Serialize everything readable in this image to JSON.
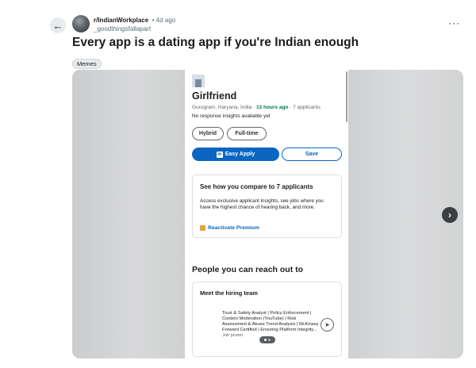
{
  "post": {
    "subreddit": "r/IndianWorkplace",
    "time": "• 4d ago",
    "username": "_goodthingsfallapart",
    "title": "Every app is a dating app if you're Indian enough",
    "flair": "Memes",
    "more_label": "···",
    "back_label": "←"
  },
  "screenshot": {
    "job_title": "Girlfriend",
    "location": "Gurugram, Haryana, India · ",
    "posted_highlight": "13 hours ago",
    "applicants": " · 7 applicants",
    "insight_note": "No response insights available yet",
    "pills": [
      "Hybrid",
      "Full-time"
    ],
    "apply_label": "Easy Apply",
    "save_label": "Save",
    "compare_heading": "See how you compare to 7 applicants",
    "compare_body": "Access exclusive applicant insights, see jobs where you have the highest chance of hearing back, and more.",
    "premium_label": "Reactivate Premium",
    "reach_title": "People you can reach out to",
    "team_heading": "Meet the hiring team",
    "poster_headline": "Trust & Safety Analyst | Policy Enforcement | Content Moderation (YouTube) | Risk Assessment & Abuse Trend Analysis | McKinsey Forward Certified | Ensuring Platform Integrity...",
    "poster_role": "Job poster"
  },
  "carousel": {
    "next_label": "›",
    "pages": 2,
    "current_page": 1
  },
  "colors": {
    "linkedin_blue": "#0a66c2",
    "highlight_green": "#01754f",
    "premium_gold": "#e7a33e"
  }
}
